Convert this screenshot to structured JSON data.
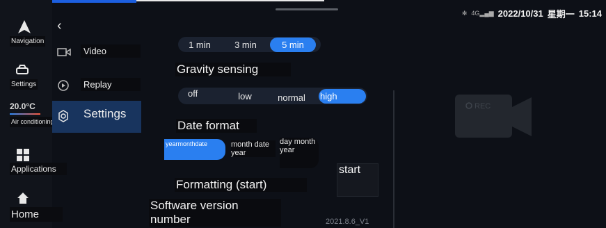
{
  "status_bar": {
    "bt_icon": "bluetooth-icon",
    "signal": "4G",
    "date": "2022/10/31",
    "weekday": "星期一",
    "time": "15:14"
  },
  "sidebar": {
    "navigation": "Navigation",
    "settings": "Settings",
    "temperature": "20.0°C",
    "air_conditioning": "Air conditioning",
    "applications": "Applications",
    "home": "Home"
  },
  "menu": {
    "video": "Video",
    "replay": "Replay",
    "settings": "Settings"
  },
  "recording_duration": {
    "options": [
      "1 min",
      "3 min",
      "5 min"
    ],
    "selected": "5 min"
  },
  "gravity": {
    "title": "Gravity sensing",
    "options": [
      "off",
      "low",
      "normal",
      "high"
    ],
    "selected": "high"
  },
  "date_format": {
    "title": "Date format",
    "options": [
      "yearmonthdate",
      "month date year",
      "day month year"
    ],
    "selected": "yearmonthdate"
  },
  "formatting": {
    "title": "Formatting (start)",
    "button": "start"
  },
  "software": {
    "title": "Software version number",
    "version": "2021.8.6_V1"
  },
  "camera": {
    "rec_label": "REC"
  },
  "colors": {
    "accent": "#2a7ff0",
    "background": "#0d1017"
  }
}
